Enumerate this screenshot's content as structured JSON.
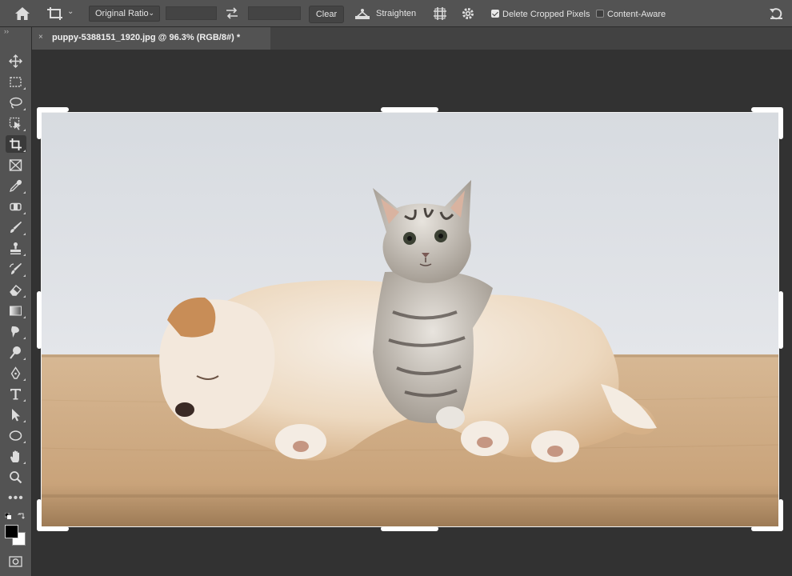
{
  "options_bar": {
    "home_icon": "home-icon",
    "tool_icon": "crop-tool-icon",
    "ratio": "Original Ratio",
    "width_value": "",
    "height_value": "",
    "clear_label": "Clear",
    "straighten_label": "Straighten",
    "grid_icon": "overlay-grid-icon",
    "settings_icon": "gear-icon",
    "delete_cropped_label": "Delete Cropped Pixels",
    "delete_cropped_checked": true,
    "content_aware_label": "Content-Aware",
    "content_aware_checked": false,
    "reset_icon": "reset-icon"
  },
  "toolbar": {
    "collapse_label": "››",
    "tools": [
      {
        "name": "move",
        "icon": "move-icon"
      },
      {
        "name": "rectangular-marquee",
        "icon": "marquee-icon"
      },
      {
        "name": "lasso",
        "icon": "lasso-icon"
      },
      {
        "name": "object-selection",
        "icon": "object-selection-icon"
      },
      {
        "name": "crop",
        "icon": "crop-icon",
        "active": true
      },
      {
        "name": "frame",
        "icon": "frame-icon"
      },
      {
        "name": "eyedropper",
        "icon": "eyedropper-icon"
      },
      {
        "name": "spot-healing",
        "icon": "healing-icon"
      },
      {
        "name": "brush",
        "icon": "brush-icon"
      },
      {
        "name": "clone-stamp",
        "icon": "stamp-icon"
      },
      {
        "name": "history-brush",
        "icon": "history-brush-icon"
      },
      {
        "name": "eraser",
        "icon": "eraser-icon"
      },
      {
        "name": "gradient",
        "icon": "gradient-icon"
      },
      {
        "name": "blur",
        "icon": "blur-icon"
      },
      {
        "name": "dodge",
        "icon": "dodge-icon"
      },
      {
        "name": "pen",
        "icon": "pen-icon"
      },
      {
        "name": "type",
        "icon": "type-icon"
      },
      {
        "name": "path-selection",
        "icon": "path-selection-icon"
      },
      {
        "name": "ellipse",
        "icon": "ellipse-icon"
      },
      {
        "name": "hand",
        "icon": "hand-icon"
      },
      {
        "name": "zoom",
        "icon": "zoom-icon"
      }
    ],
    "more_label": "•••",
    "foreground_color": "#000000",
    "background_color": "#ffffff"
  },
  "document": {
    "tab_close": "×",
    "tab_title": "puppy-5388151_1920.jpg @ 96.3% (RGB/8#) *"
  },
  "colors": {
    "panel": "#535353",
    "canvas_bg": "#323232",
    "crop_handle": "#ffffff"
  }
}
